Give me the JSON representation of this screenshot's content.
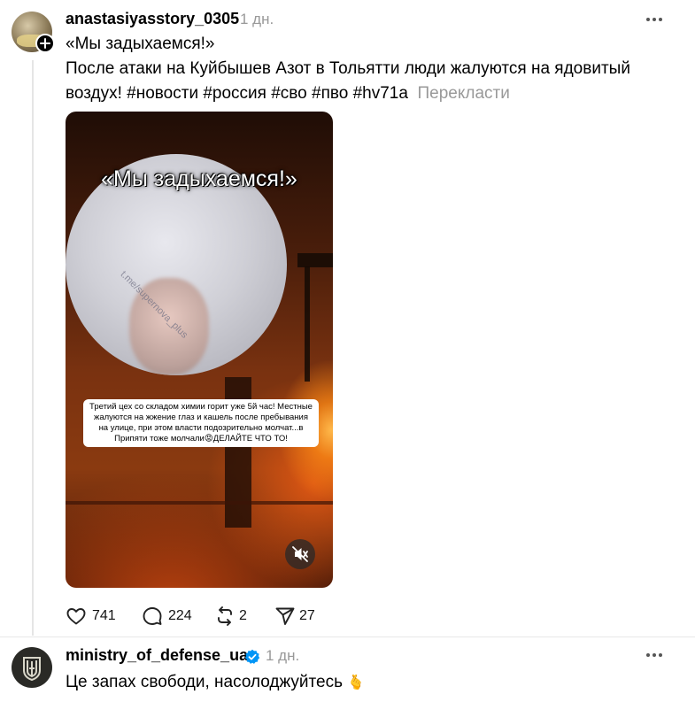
{
  "post1": {
    "username": "anastasiyasstory_0305",
    "time": "1 дн.",
    "text_line1": "«Мы задыхаемся!»",
    "text_line2": "После атаки на Куйбышев Азот в Тольятти люди жалуются на ядовитый",
    "text_line3": "воздух! #новости #россия #сво #пво #hv71a",
    "translate_label": "Перекласти",
    "media": {
      "headline": "«Мы задыхаемся!»",
      "watermark": "t.me/supernova_plus",
      "caption": "Третий цех со складом химии горит уже 5й час! Местные жалуются на жжение глаз и кашель после пребывания на улице, при этом власти подозрительно молчат...в Припяти тоже молчали😡ДЕЛАЙТЕ ЧТО ТО!"
    },
    "stats": {
      "likes": "741",
      "comments": "224",
      "reposts": "2",
      "shares": "27"
    }
  },
  "post2": {
    "username": "ministry_of_defense_ua",
    "time": "1 дн.",
    "text": "Це запах свободи, насолоджуйтесь",
    "emoji": "🫰"
  },
  "icons": {
    "follow": "plus-icon",
    "more": "more-horizontal-icon",
    "verified": "verified-badge-icon",
    "like": "heart-icon",
    "comment": "comment-icon",
    "repost": "repost-icon",
    "share": "send-icon",
    "mute": "speaker-muted-icon"
  },
  "colors": {
    "verified": "#0095f6",
    "secondary_text": "#999999",
    "thread_line": "#e5e5e5"
  }
}
